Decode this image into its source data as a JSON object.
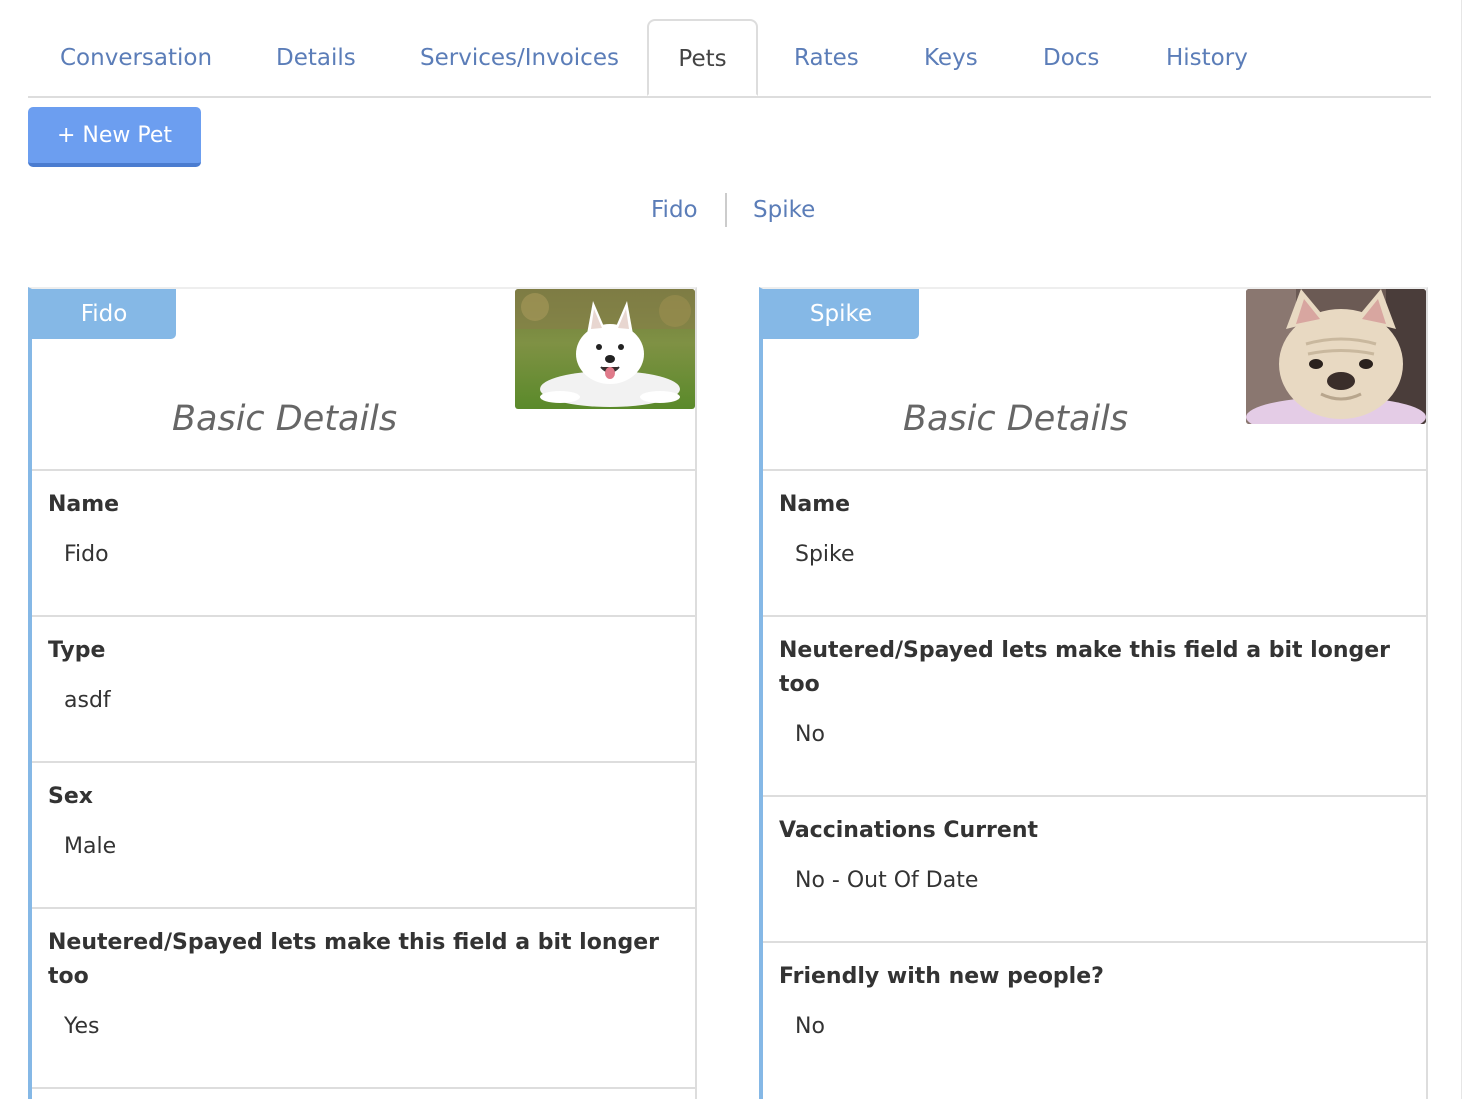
{
  "tabs": [
    {
      "label": "Conversation",
      "active": false
    },
    {
      "label": "Details",
      "active": false
    },
    {
      "label": "Services/Invoices",
      "active": false
    },
    {
      "label": "Pets",
      "active": true
    },
    {
      "label": "Rates",
      "active": false
    },
    {
      "label": "Keys",
      "active": false
    },
    {
      "label": "Docs",
      "active": false
    },
    {
      "label": "History",
      "active": false
    }
  ],
  "toolbar": {
    "new_pet_label": "+ New Pet"
  },
  "pet_links": [
    "Fido",
    "Spike"
  ],
  "colors": {
    "accent": "#6c9ef0",
    "card_accent": "#85b8e6",
    "link": "#5b7db8"
  },
  "pets": [
    {
      "name_tab": "Fido",
      "photo_icon": "white-dog-photo",
      "section_title": "Basic Details",
      "fields": [
        {
          "label": "Name",
          "value": "Fido"
        },
        {
          "label": "Type",
          "value": "asdf"
        },
        {
          "label": "Sex",
          "value": "Male"
        },
        {
          "label": "Neutered/Spayed lets make this field a bit longer too",
          "value": "Yes"
        }
      ]
    },
    {
      "name_tab": "Spike",
      "photo_icon": "bulldog-photo",
      "section_title": "Basic Details",
      "fields": [
        {
          "label": "Name",
          "value": "Spike"
        },
        {
          "label": "Neutered/Spayed lets make this field a bit longer too",
          "value": "No"
        },
        {
          "label": "Vaccinations Current",
          "value": "No - Out Of Date"
        },
        {
          "label": "Friendly with new people?",
          "value": "No"
        }
      ]
    }
  ]
}
